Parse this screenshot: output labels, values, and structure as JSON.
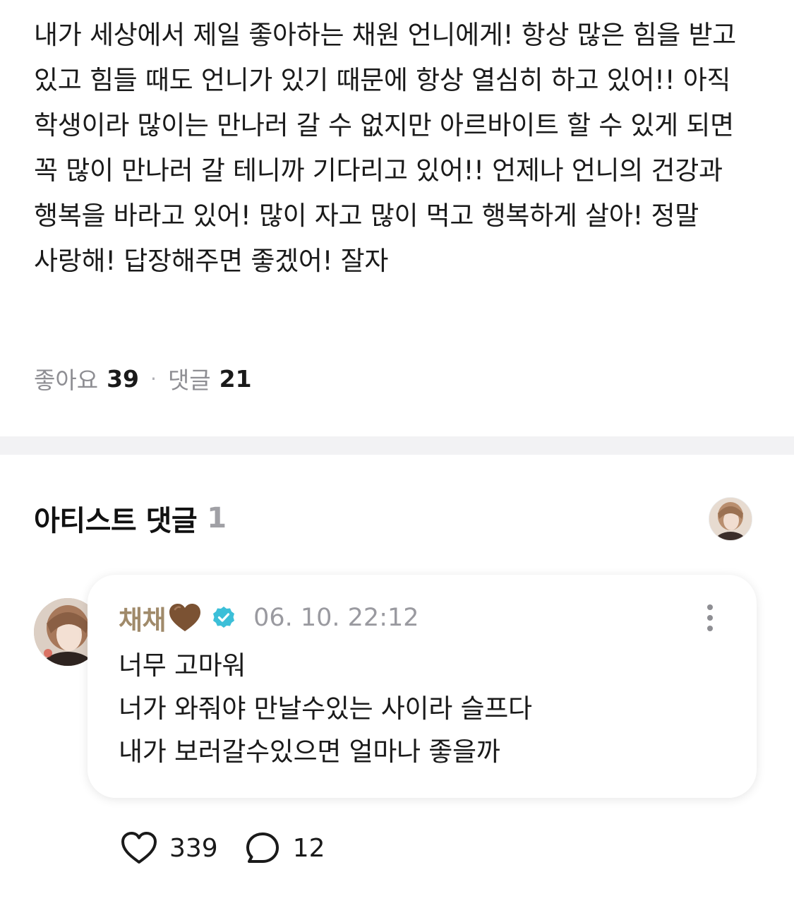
{
  "post": {
    "body": "내가 세상에서 제일 좋아하는 채원 언니에게! 항상 많은 힘을 받고 있고 힘들 때도 언니가 있기 때문에 항상 열심히 하고 있어!! 아직 학생이라 많이는 만나러 갈 수 없지만 아르바이트 할 수 있게 되면 꼭 많이 만나러 갈 테니까 기다리고 있어!! 언제나 언니의 건강과 행복을 바라고 있어! 많이 자고 많이 먹고 행복하게 살아! 정말 사랑해! 답장해주면 좋겠어! 잘자",
    "stats": {
      "likes_label": "좋아요",
      "likes_count": "39",
      "separator": "·",
      "comments_label": "댓글",
      "comments_count": "21"
    }
  },
  "artist_comments": {
    "title": "아티스트 댓글",
    "count": "1",
    "comment": {
      "author": "채채",
      "author_emoji": "brown-heart",
      "verified": true,
      "timestamp": "06. 10. 22:12",
      "lines": [
        "너무 고마워",
        "너가 와줘야 만날수있는 사이라 슬프다",
        "내가 보러갈수있으면 얼마나 좋을까"
      ],
      "likes": "339",
      "replies": "12"
    }
  },
  "colors": {
    "author": "#a08a6a",
    "verified": "#3cbfd8",
    "muted": "#8e8e93",
    "divider": "#f2f2f4"
  },
  "icons": {
    "verified": "verified-badge-icon",
    "more": "more-vertical-icon",
    "like": "heart-outline-icon",
    "reply": "speech-bubble-icon"
  }
}
